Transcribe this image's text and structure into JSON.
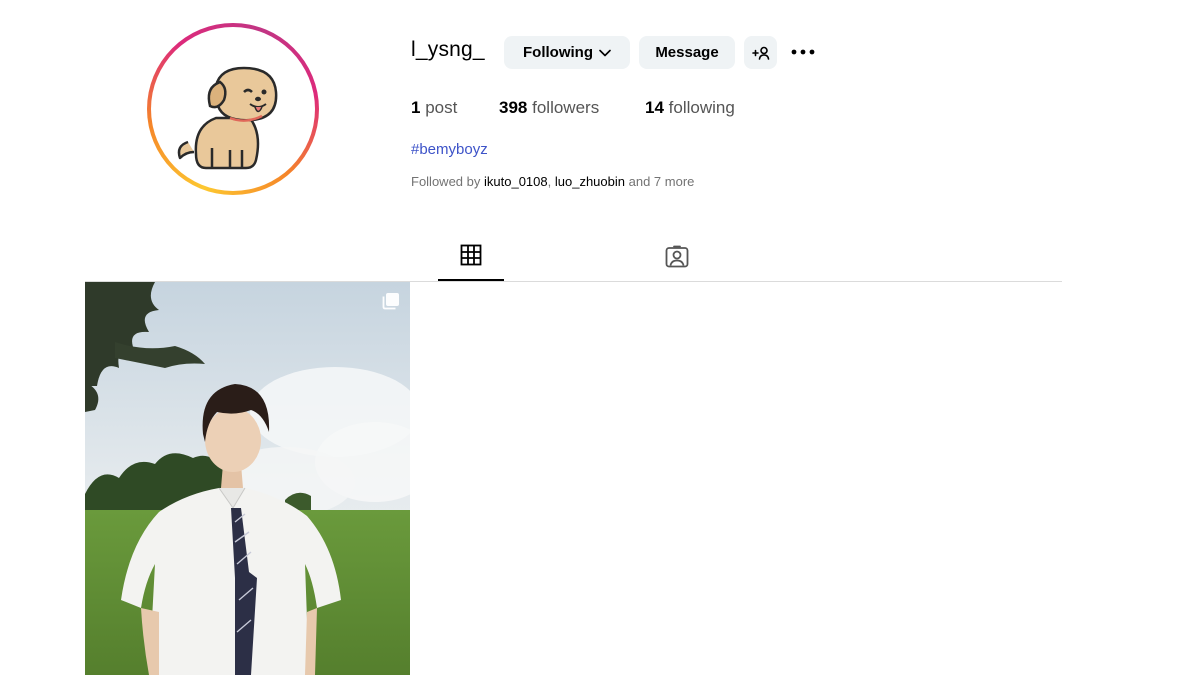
{
  "profile": {
    "username": "l_ysng_",
    "following_label": "Following",
    "message_label": "Message",
    "more_icon": "more-horizontal-icon",
    "add_user_icon": "add-user-icon"
  },
  "stats": {
    "posts_count": "1",
    "posts_label": "post",
    "followers_count": "398",
    "followers_label": "followers",
    "following_count": "14",
    "following_label": "following"
  },
  "bio": {
    "hashtag": "#bemyboyz"
  },
  "followed_by": {
    "prefix": "Followed by",
    "account1": "ikuto_0108",
    "separator": ",",
    "account2": "luo_zhuobin",
    "suffix": "and 7 more"
  },
  "tabs": [
    {
      "name": "posts",
      "icon": "grid-icon",
      "active": true
    },
    {
      "name": "tagged",
      "icon": "tagged-icon",
      "active": false
    }
  ],
  "colors": {
    "button_bg": "#eff3f5",
    "link": "#3d53c8",
    "divider": "#dbdbdb",
    "ring_gradient": [
      "#fdc830",
      "#f58529",
      "#dd2a7b",
      "#c13584"
    ]
  }
}
